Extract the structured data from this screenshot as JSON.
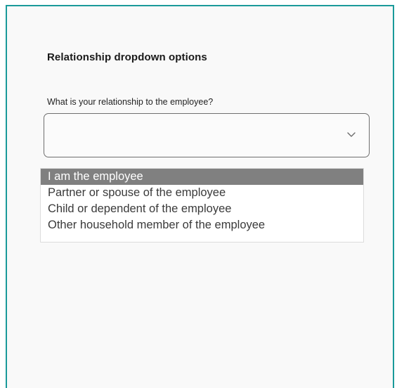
{
  "panel": {
    "title": "Relationship dropdown options"
  },
  "field": {
    "label": "What is your relationship to the employee?",
    "value": ""
  },
  "dropdown": {
    "icon": "chevron-down-icon",
    "options": [
      {
        "label": "I am the employee",
        "selected": true
      },
      {
        "label": "Partner or spouse of the employee",
        "selected": false
      },
      {
        "label": "Child or dependent of the employee",
        "selected": false
      },
      {
        "label": "Other household member of the employee",
        "selected": false
      }
    ]
  },
  "colors": {
    "frame_border": "#1a9a9a",
    "highlight": "#808080"
  }
}
